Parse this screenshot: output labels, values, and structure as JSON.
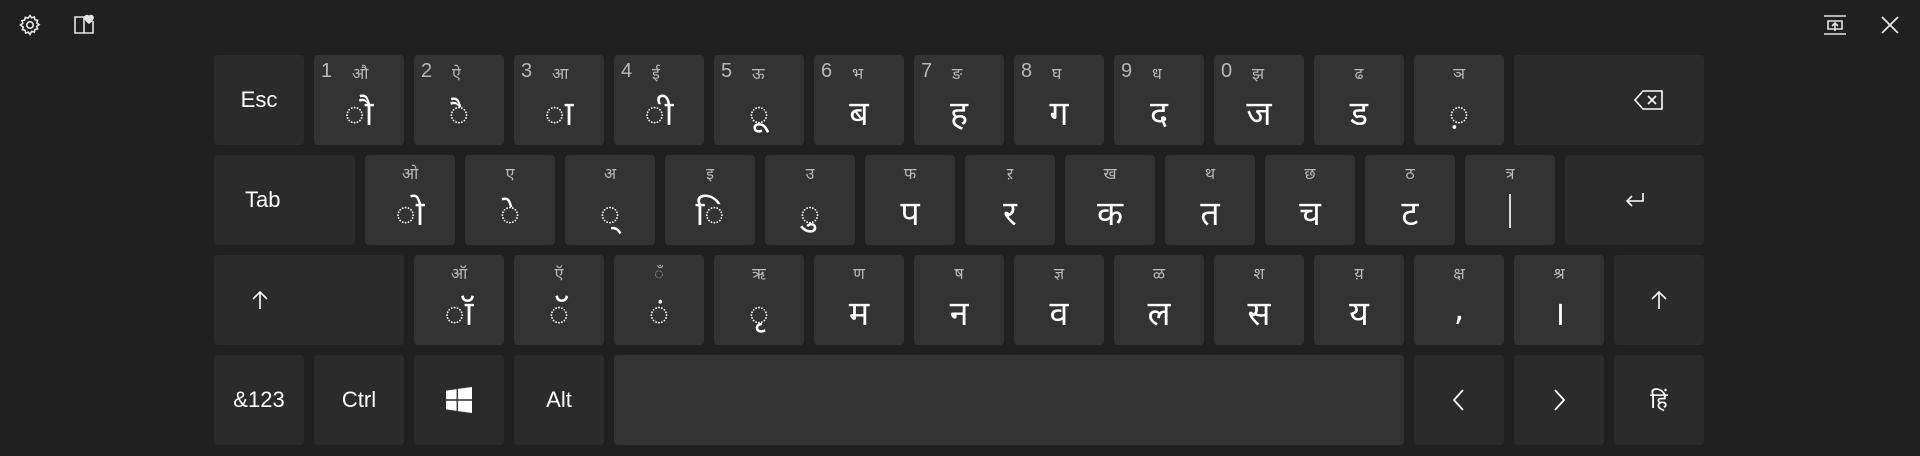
{
  "colors": {
    "background": "#202020",
    "key": "#333333",
    "key_function": "#2b2b2b",
    "text": "#ffffff",
    "secondary_text": "#b8b8b8"
  },
  "toolbar": {
    "left_icons": [
      "settings-gear-icon",
      "emoji-heart-icon"
    ],
    "right_icons": [
      "dock-undock-icon",
      "close-icon"
    ]
  },
  "keys": {
    "esc": "Esc",
    "tab": "Tab",
    "sym": "&123",
    "ctrl": "Ctrl",
    "alt": "Alt",
    "lang": "हिं"
  },
  "row1": [
    {
      "num": "1",
      "sec": "औ",
      "pri": "ौ"
    },
    {
      "num": "2",
      "sec": "ऐ",
      "pri": "ै"
    },
    {
      "num": "3",
      "sec": "आ",
      "pri": "ा"
    },
    {
      "num": "4",
      "sec": "ई",
      "pri": "ी"
    },
    {
      "num": "5",
      "sec": "ऊ",
      "pri": "ू"
    },
    {
      "num": "6",
      "sec": "भ",
      "pri": "ब"
    },
    {
      "num": "7",
      "sec": "ङ",
      "pri": "ह"
    },
    {
      "num": "8",
      "sec": "घ",
      "pri": "ग"
    },
    {
      "num": "9",
      "sec": "ध",
      "pri": "द"
    },
    {
      "num": "0",
      "sec": "झ",
      "pri": "ज"
    },
    {
      "num": "",
      "sec": "ढ",
      "pri": "ड"
    },
    {
      "num": "",
      "sec": "ञ",
      "pri": "़"
    }
  ],
  "row2": [
    {
      "sec": "ओ",
      "pri": "ो"
    },
    {
      "sec": "ए",
      "pri": "े"
    },
    {
      "sec": "अ",
      "pri": "्"
    },
    {
      "sec": "इ",
      "pri": "ि"
    },
    {
      "sec": "उ",
      "pri": "ु"
    },
    {
      "sec": "फ",
      "pri": "प"
    },
    {
      "sec": "ऱ",
      "pri": "र"
    },
    {
      "sec": "ख",
      "pri": "क"
    },
    {
      "sec": "थ",
      "pri": "त"
    },
    {
      "sec": "छ",
      "pri": "च"
    },
    {
      "sec": "ठ",
      "pri": "ट"
    },
    {
      "sec": "त्र",
      "pri": "|"
    }
  ],
  "row3": [
    {
      "sec": "ऑ",
      "pri": "ॉ"
    },
    {
      "sec": "ऍ",
      "pri": "ॅ"
    },
    {
      "sec": "ँ",
      "pri": "ं"
    },
    {
      "sec": "ऋ",
      "pri": "ृ"
    },
    {
      "sec": "ण",
      "pri": "म"
    },
    {
      "sec": "ष",
      "pri": "न"
    },
    {
      "sec": "ज्ञ",
      "pri": "व"
    },
    {
      "sec": "ळ",
      "pri": "ल"
    },
    {
      "sec": "श",
      "pri": "स"
    },
    {
      "sec": "य़",
      "pri": "य"
    },
    {
      "sec": "क्ष",
      "pri": ","
    },
    {
      "sec": "श्र",
      "pri": "।"
    }
  ]
}
